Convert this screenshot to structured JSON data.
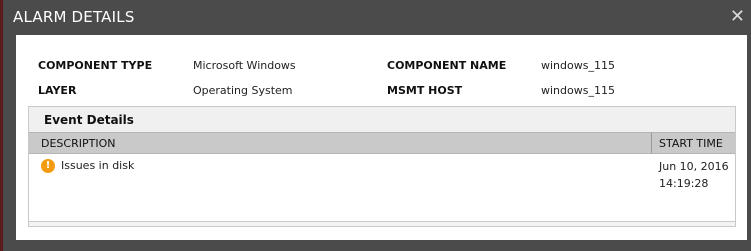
{
  "modal": {
    "title": "ALARM DETAILS",
    "close_glyph": "✕"
  },
  "details": {
    "component_type_label": "COMPONENT TYPE",
    "component_type_value": "Microsoft Windows",
    "layer_label": "LAYER",
    "layer_value": "Operating System",
    "component_name_label": "COMPONENT NAME",
    "component_name_value": "windows_115",
    "msmt_host_label": "MSMT HOST",
    "msmt_host_value": "windows_115"
  },
  "events": {
    "section_title": "Event Details",
    "columns": [
      "DESCRIPTION",
      "START TIME"
    ],
    "rows": [
      {
        "icon": "warning-icon",
        "description": "Issues in disk",
        "start_time": "Jun 10, 2016 14:19:28"
      }
    ]
  },
  "colors": {
    "header_bg": "#4b4b4b",
    "warning": "#f39c12",
    "table_header_bg": "#c9c9c9"
  }
}
